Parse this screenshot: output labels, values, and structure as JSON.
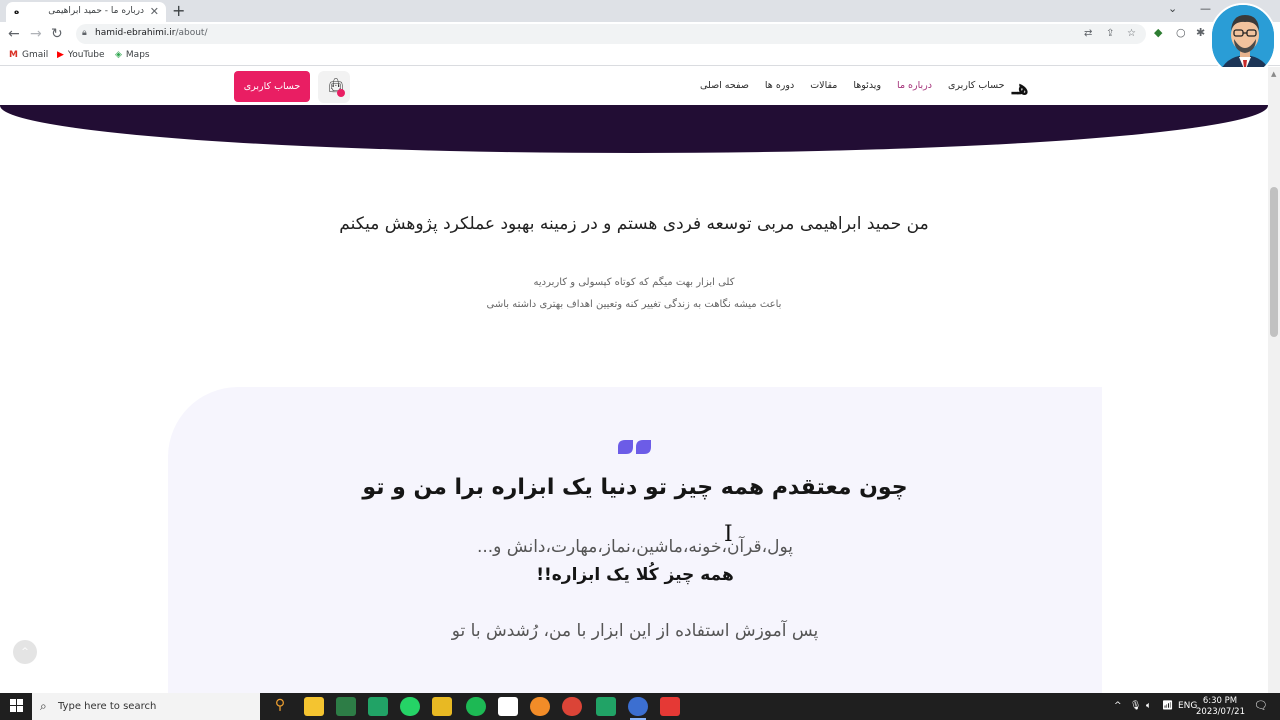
{
  "browser": {
    "tab_title": "درباره ما - حمید ابراهیمی",
    "tab_favicon": "ه",
    "tab_close": "✕",
    "new_tab": "+",
    "url_domain": "hamid-ebrahimi.ir",
    "url_path": "/about/",
    "bookmarks": [
      {
        "label": "Gmail",
        "icon": "gmail-icon"
      },
      {
        "label": "YouTube",
        "icon": "youtube-icon"
      },
      {
        "label": "Maps",
        "icon": "maps-icon"
      }
    ]
  },
  "site": {
    "logo": "هـ",
    "nav": [
      {
        "label": "صفحه اصلی",
        "active": false
      },
      {
        "label": "دوره ها",
        "active": false
      },
      {
        "label": "مقالات",
        "active": false
      },
      {
        "label": "ویدئوها",
        "active": false
      },
      {
        "label": "درباره ما",
        "active": true
      },
      {
        "label": "حساب کاربری",
        "active": false
      }
    ],
    "account_button": "حساب کاربری",
    "cart_icon": "shopping-bag-icon",
    "accent_color": "#e91e63",
    "band_color": "#220d34"
  },
  "intro": {
    "title": "من حمید ابراهیمی مربی توسعه فردی هستم و در زمینه بهبود عملکرد پژوهش میکنم",
    "line1": "کلی ابزار بهت میگم که کوتاه کپسولی و کاربردیه",
    "line2": "باعث میشه نگاهت به زندگی تغییر کنه وتعیین اهداف بهتری داشته باشی"
  },
  "quote": {
    "icon": "quote-icon",
    "icon_color": "#6c5ce7",
    "title": "چون معتقدم همه چیز تو دنیا یک ابزاره برا من و تو",
    "list": "پول،قرآن،خونه،ماشین،نماز،مهارت،دانش و...",
    "strong": "همه چیز کُلا یک ابزاره!!",
    "footer": "پس آموزش استفاده از این ابزار با من، رُشدش با تو"
  },
  "taskbar": {
    "search_placeholder": "Type here to search",
    "language": "ENG",
    "time": "6:30 PM",
    "date": "2023/07/21"
  }
}
